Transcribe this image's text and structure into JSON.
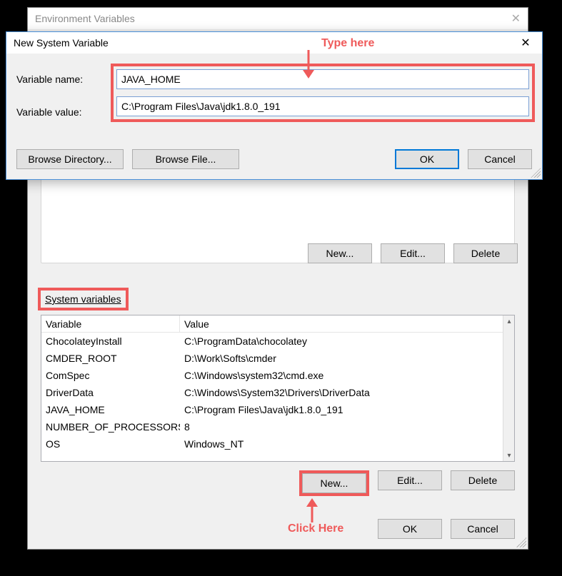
{
  "envWindow": {
    "title": "Environment Variables",
    "userButtons": {
      "new": "New...",
      "edit": "Edit...",
      "delete": "Delete"
    },
    "systemLabel": "System variables",
    "sysHeaders": {
      "var": "Variable",
      "val": "Value"
    },
    "sysRows": [
      {
        "var": "ChocolateyInstall",
        "val": "C:\\ProgramData\\chocolatey"
      },
      {
        "var": "CMDER_ROOT",
        "val": "D:\\Work\\Softs\\cmder"
      },
      {
        "var": "ComSpec",
        "val": "C:\\Windows\\system32\\cmd.exe"
      },
      {
        "var": "DriverData",
        "val": "C:\\Windows\\System32\\Drivers\\DriverData"
      },
      {
        "var": "JAVA_HOME",
        "val": "C:\\Program Files\\Java\\jdk1.8.0_191"
      },
      {
        "var": "NUMBER_OF_PROCESSORS",
        "val": "8"
      },
      {
        "var": "OS",
        "val": "Windows_NT"
      }
    ],
    "sysButtons": {
      "new": "New...",
      "edit": "Edit...",
      "delete": "Delete"
    },
    "bottomButtons": {
      "ok": "OK",
      "cancel": "Cancel"
    }
  },
  "dialog": {
    "title": "New System Variable",
    "labelName": "Variable name:",
    "labelValue": "Variable value:",
    "valueName": "JAVA_HOME",
    "valueValue": "C:\\Program Files\\Java\\jdk1.8.0_191",
    "browseDir": "Browse Directory...",
    "browseFile": "Browse File...",
    "ok": "OK",
    "cancel": "Cancel"
  },
  "annotations": {
    "typeHere": "Type here",
    "clickHere": "Click Here"
  },
  "colors": {
    "highlight": "#ef5a5a",
    "primaryBorder": "#0078d7"
  }
}
